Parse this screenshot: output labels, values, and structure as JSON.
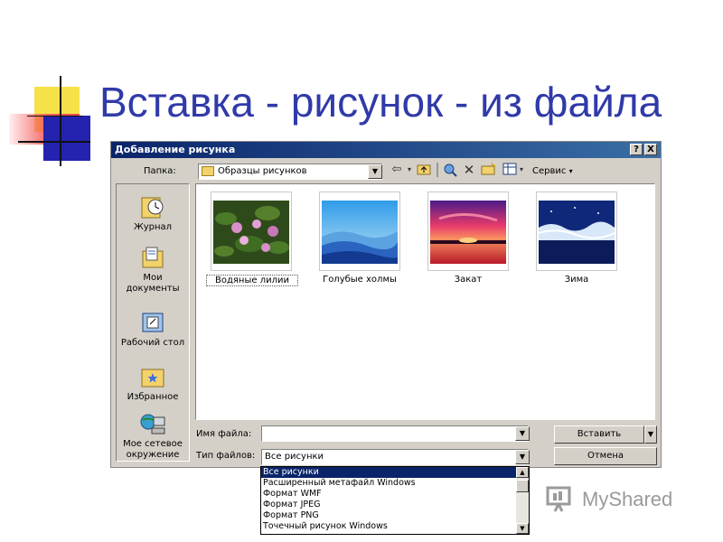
{
  "slide": {
    "title": "Вставка - рисунок - из файла"
  },
  "dialog": {
    "title": "Добавление рисунка",
    "help_button": "?",
    "close_button": "X",
    "folder_label": "Папка:",
    "folder_value": "Образцы рисунков",
    "service_label": "Сервис",
    "places": [
      {
        "label": "Журнал",
        "icon": "history-icon"
      },
      {
        "label": "Мои документы",
        "icon": "my-documents-icon"
      },
      {
        "label": "Рабочий стол",
        "icon": "desktop-icon"
      },
      {
        "label": "Избранное",
        "icon": "favorites-icon"
      },
      {
        "label": "Мое сетевое окружение",
        "icon": "network-icon"
      }
    ],
    "files": [
      {
        "label": "Водяные лилии",
        "icon": "water-lilies-thumbnail"
      },
      {
        "label": "Голубые холмы",
        "icon": "blue-hills-thumbnail"
      },
      {
        "label": "Закат",
        "icon": "sunset-thumbnail"
      },
      {
        "label": "Зима",
        "icon": "winter-thumbnail"
      }
    ],
    "filename_label": "Имя файла:",
    "filename_value": "",
    "filetype_label": "Тип файлов:",
    "filetype_value": "Все рисунки",
    "insert_button": "Вставить",
    "cancel_button": "Отмена",
    "filetype_options": [
      "Все рисунки",
      "Расширенный метафайл Windows",
      "Формат WMF",
      "Формат JPEG",
      "Формат PNG",
      "Точечный рисунок Windows"
    ]
  },
  "brand": {
    "name": "MyShared"
  },
  "colors": {
    "title_text": "#303aa8",
    "titlebar": "#0a246a",
    "dialog_face": "#d4d0c8"
  }
}
